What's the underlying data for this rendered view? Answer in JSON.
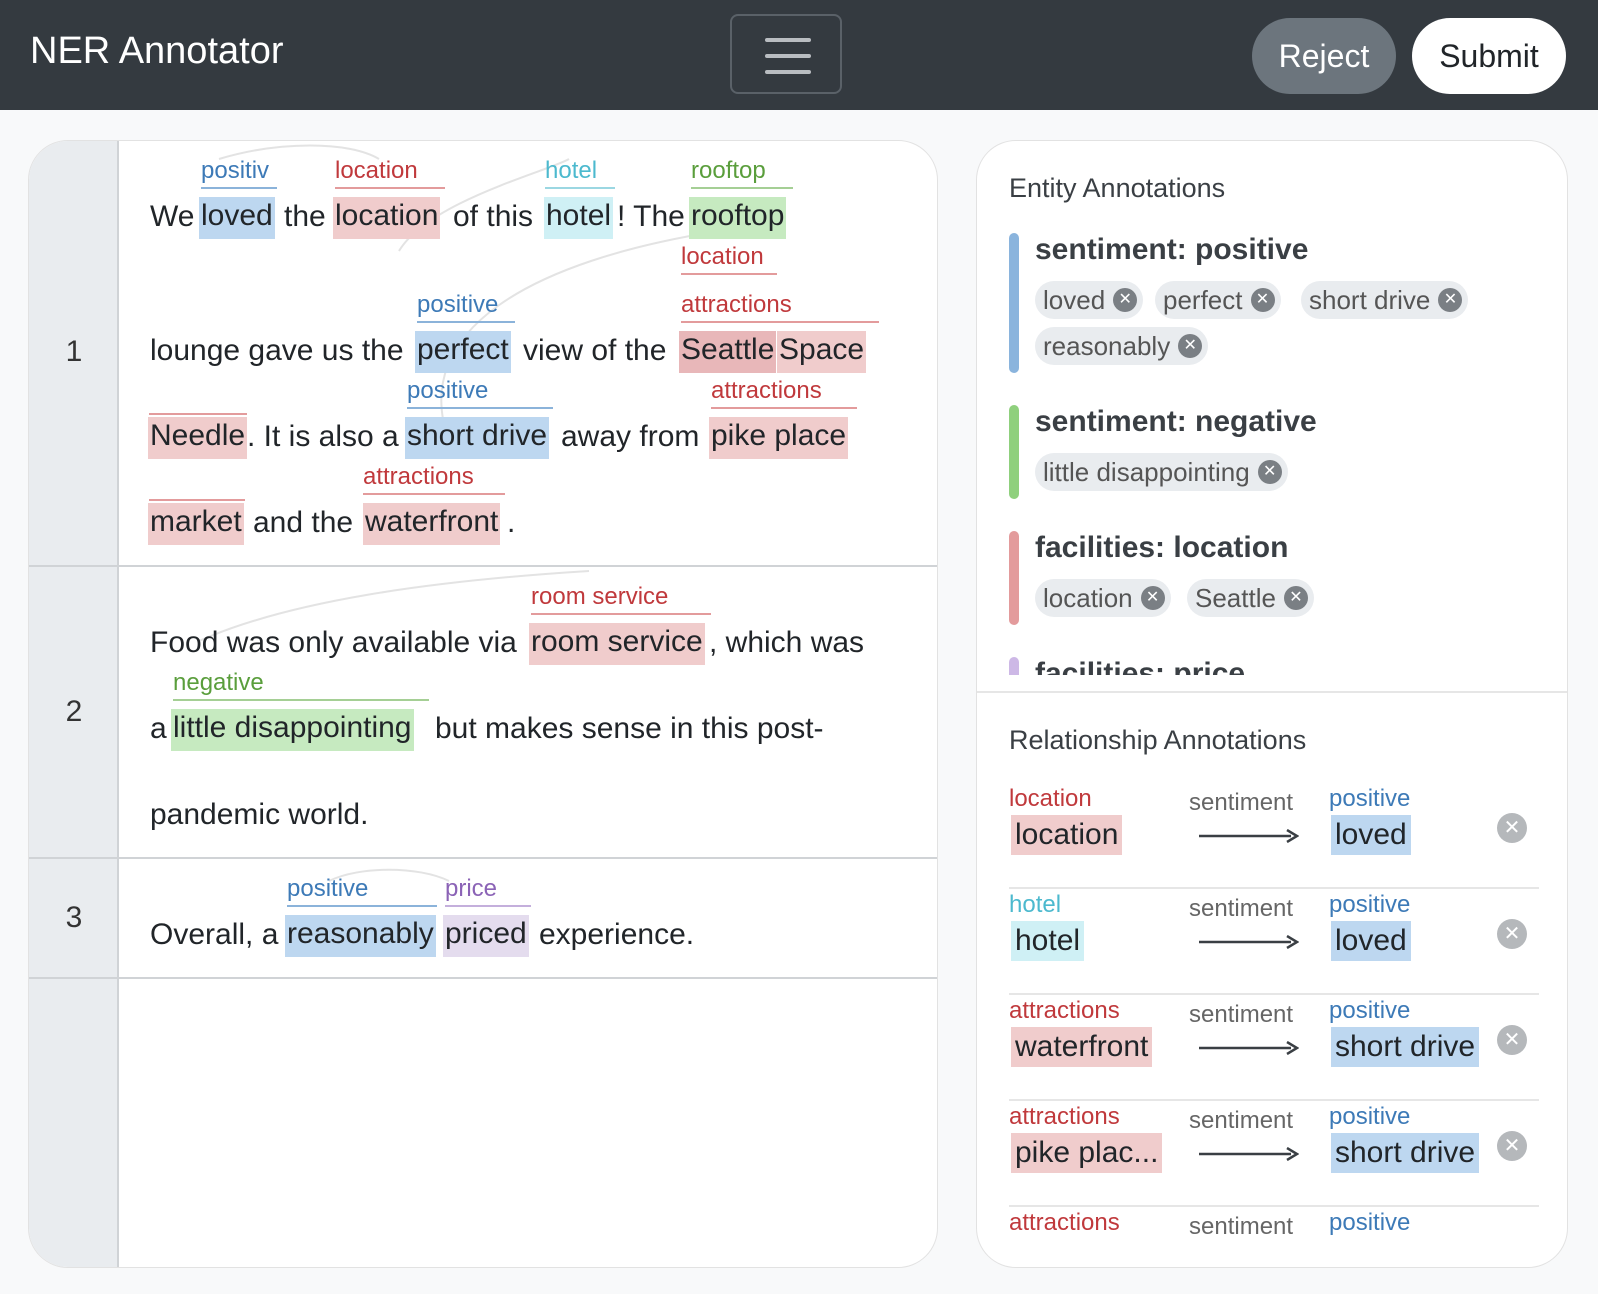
{
  "navbar": {
    "brand": "NER Annotator",
    "reject_label": "Reject",
    "submit_label": "Submit"
  },
  "document": {
    "line_numbers": [
      "1",
      "2",
      "3"
    ],
    "text": {
      "s1_we": "We",
      "s1_the": "the",
      "s1_ofthis": "of this",
      "s1_the2": "! The",
      "s2_lounge": "lounge gave us the",
      "s2_viewof": "view of the",
      "s3_itisalso": ". It is also a",
      "s3_awayfrom": "away from",
      "s4_andthe": "and the",
      "s4_period": ".",
      "p2_food": "Food was only available via",
      "p2_which": ", which was",
      "p2_a": "a",
      "p2_but": "but makes sense in this post-",
      "p2_pandemic": "pandemic world.",
      "p3_overall": "Overall, a",
      "p3_exp": "experience."
    },
    "tokens": {
      "loved": "loved",
      "location": "location",
      "hotel": "hotel",
      "rooftop": "rooftop",
      "perfect": "perfect",
      "seattle": "Seattle",
      "space": "Space",
      "needle": "Needle",
      "short_drive": "short drive",
      "pike_place": "pike place",
      "market": "market",
      "waterfront": "waterfront",
      "room_service": "room service",
      "little_disappointing": "little disappointing",
      "reasonably": "reasonably",
      "priced": "priced"
    },
    "labels": {
      "positiv": "positiv",
      "location": "location",
      "hotel": "hotel",
      "rooftop": "rooftop",
      "location2": "location",
      "positive1": "positive",
      "attractions1": "attractions",
      "positive2": "positive",
      "attractions2": "attractions",
      "attractions3": "attractions",
      "room_service": "room service",
      "negative": "negative",
      "positive3": "positive",
      "price": "price"
    }
  },
  "entities": {
    "title": "Entity Annotations",
    "groups": [
      {
        "name": "sentiment: positive",
        "color": "#8ab4dd",
        "items": [
          "loved",
          "perfect",
          "short drive",
          "reasonably"
        ]
      },
      {
        "name": "sentiment: negative",
        "color": "#8fd07d",
        "items": [
          "little disappointing"
        ]
      },
      {
        "name": "facilities: location",
        "color": "#e39b9c",
        "items": [
          "location",
          "Seattle"
        ]
      },
      {
        "name": "facilities: price",
        "color": "#cdb8e6",
        "items": []
      }
    ]
  },
  "relationships": {
    "title": "Relationship Annotations",
    "rows": [
      {
        "from_label": "location",
        "from": "location",
        "relation": "sentiment",
        "to_label": "positive",
        "to": "loved"
      },
      {
        "from_label": "hotel",
        "from": "hotel",
        "relation": "sentiment",
        "to_label": "positive",
        "to": "loved"
      },
      {
        "from_label": "attractions",
        "from": "waterfront",
        "relation": "sentiment",
        "to_label": "positive",
        "to": "short drive"
      },
      {
        "from_label": "attractions",
        "from": "pike plac...",
        "relation": "sentiment",
        "to_label": "positive",
        "to": "short drive"
      },
      {
        "from_label": "attractions",
        "from": "",
        "relation": "sentiment",
        "to_label": "positive",
        "to": ""
      }
    ]
  },
  "colors": {
    "navbar": "#343a40",
    "positive": "#3d7ab7",
    "location": "#c0393c",
    "hotel": "#4cb9ce",
    "negative": "#5a9e3c",
    "price": "#8b63b6"
  }
}
